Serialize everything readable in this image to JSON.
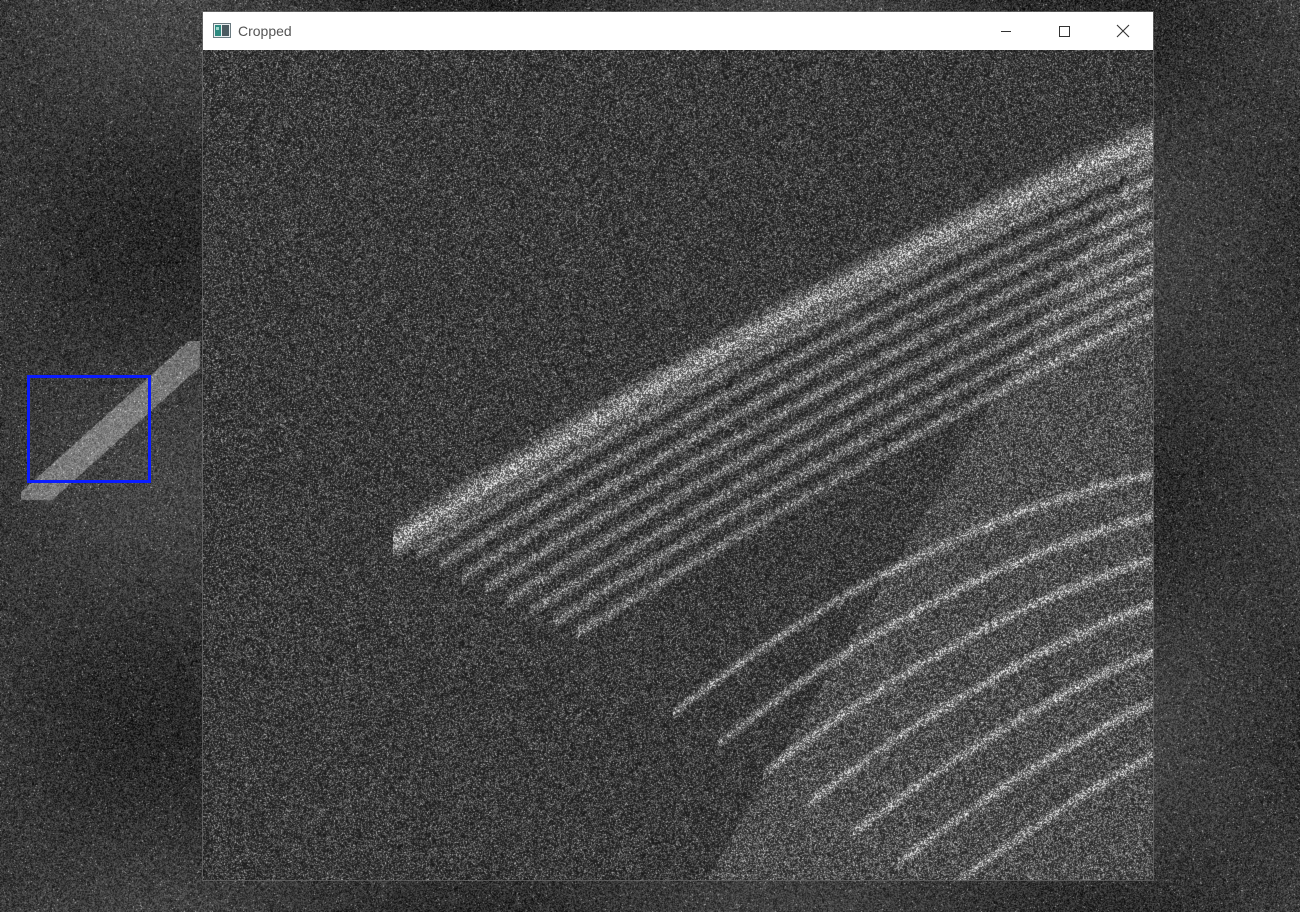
{
  "window": {
    "title": "Cropped",
    "icon": "image-app-icon",
    "controls": {
      "minimize": "minimize-icon",
      "maximize": "maximize-icon",
      "close": "close-icon"
    }
  },
  "desktop": {
    "background_image": "grayscale-radar-scan",
    "selection_color": "#0a1cff"
  },
  "cropped_view": {
    "content": "zoomed-radar-scan"
  }
}
